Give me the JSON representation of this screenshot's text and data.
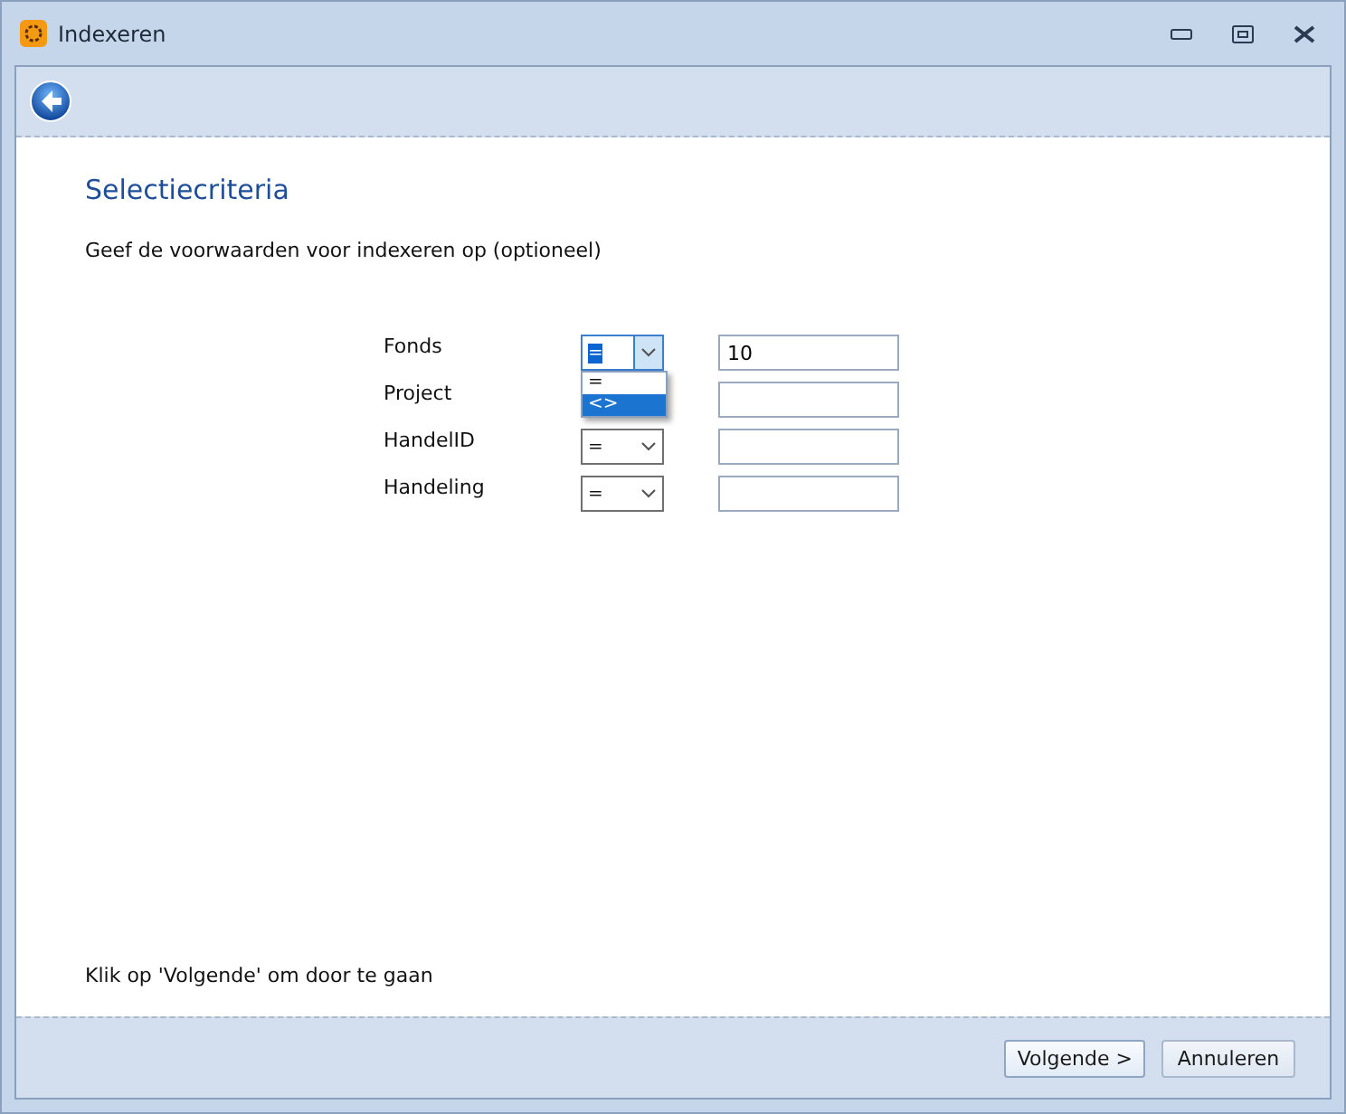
{
  "window": {
    "title": "Indexeren"
  },
  "page": {
    "heading": "Selectiecriteria",
    "instruction": "Geef de voorwaarden voor indexeren op (optioneel)",
    "hint": "Klik op 'Volgende' om door te gaan"
  },
  "criteria": [
    {
      "label": "Fonds",
      "operator": "=",
      "value": "10",
      "dropdown": {
        "options": [
          {
            "label": "=",
            "selected": false
          },
          {
            "label": "<>",
            "selected": true
          }
        ]
      }
    },
    {
      "label": "Project"
    },
    {
      "label": "HandelID",
      "operator": "="
    },
    {
      "label": "Handeling",
      "operator": "="
    }
  ],
  "buttons": [
    {
      "label": "Volgende >",
      "kind": "default"
    },
    {
      "label": "Annuleren",
      "kind": "normal"
    }
  ]
}
